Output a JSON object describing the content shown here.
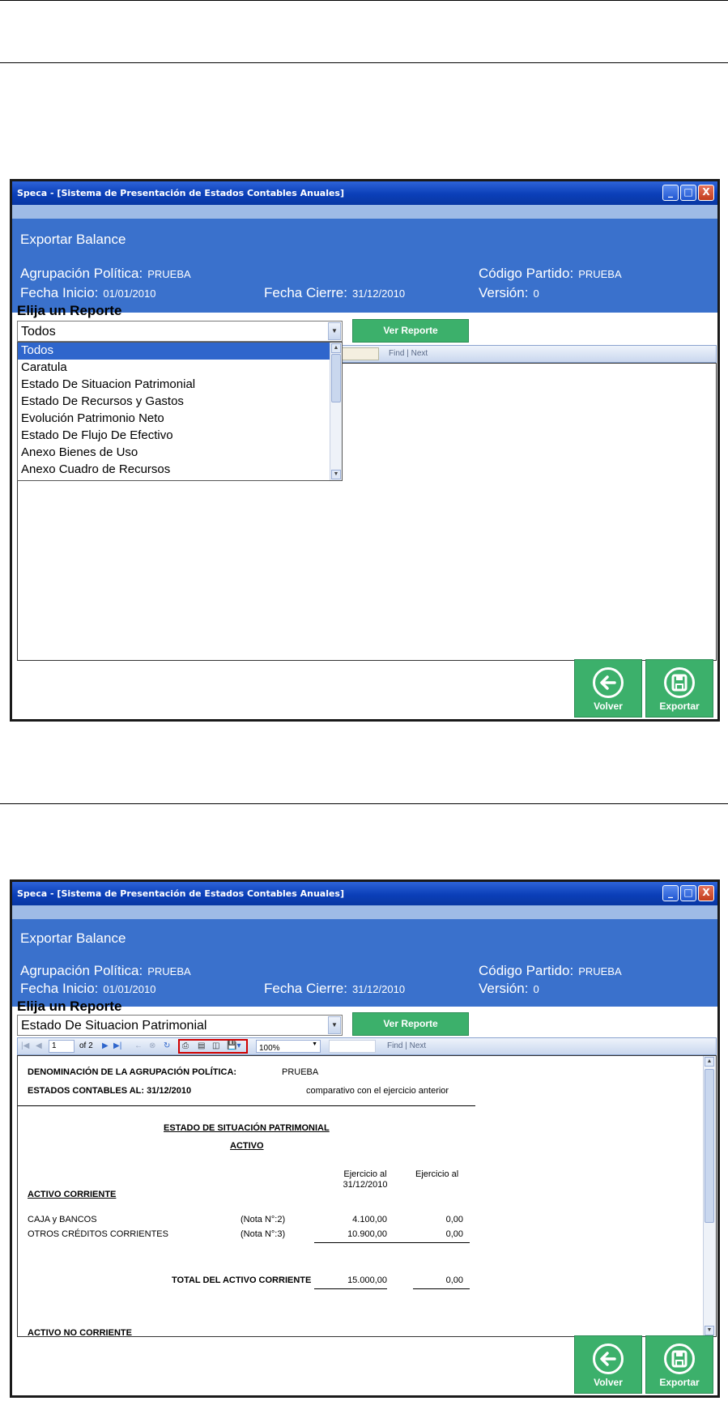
{
  "window": {
    "title": "Speca - [Sistema de Presentación de Estados Contables Anuales]",
    "min_glyph": "_",
    "max_glyph": "□",
    "close_glyph": "X"
  },
  "header": {
    "title": "Exportar Balance",
    "agrupacion_label": "Agrupación Política:",
    "agrupacion_value": "PRUEBA",
    "codigo_label": "Código Partido:",
    "codigo_value": "PRUEBA",
    "fecha_inicio_label": "Fecha Inicio:",
    "fecha_inicio_value": "01/01/2010",
    "fecha_cierre_label": "Fecha Cierre:",
    "fecha_cierre_value": "31/12/2010",
    "version_label": "Versión:",
    "version_value": "0"
  },
  "report_selector": {
    "label": "Elija un Reporte",
    "ver_reporte": "Ver Reporte"
  },
  "screen1": {
    "selected": "Todos",
    "dropdown_items": [
      "Todos",
      "Caratula",
      "Estado De Situacion Patrimonial",
      "Estado De Recursos y Gastos",
      "Evolución Patrimonio Neto",
      "Estado De Flujo De Efectivo",
      "Anexo Bienes de Uso",
      "Anexo Cuadro de Recursos"
    ],
    "toolbar_find": "Find  |  Next"
  },
  "screen2": {
    "selected": "Estado De Situacion Patrimonial",
    "toolbar": {
      "page": "1",
      "of": "of 2",
      "zoom": "100%",
      "find": "Find  |  Next"
    },
    "report": {
      "denominacion_label": "DENOMINACIÓN DE LA AGRUPACIÓN POLÍTICA:",
      "denominacion_value": "PRUEBA",
      "estados_label": "ESTADOS CONTABLES AL: 31/12/2010",
      "comparativo": "comparativo con el ejercicio anterior",
      "title": "ESTADO DE SITUACIÓN PATRIMONIAL",
      "activo": "ACTIVO",
      "col1_line1": "Ejercicio al",
      "col1_line2": "31/12/2010",
      "col2": "Ejercicio al",
      "activo_corriente": "ACTIVO CORRIENTE",
      "rows": [
        {
          "name": "CAJA y BANCOS",
          "nota": "(Nota N°:2)",
          "v1": "4.100,00",
          "v2": "0,00"
        },
        {
          "name": "OTROS CRÉDITOS CORRIENTES",
          "nota": "(Nota N°:3)",
          "v1": "10.900,00",
          "v2": "0,00"
        }
      ],
      "total_label": "TOTAL DEL ACTIVO CORRIENTE",
      "total_v1": "15.000,00",
      "total_v2": "0,00",
      "activo_no_corriente": "ACTIVO NO CORRIENTE"
    }
  },
  "buttons": {
    "volver": "Volver",
    "exportar": "Exportar"
  },
  "colors": {
    "header_blue": "#3a71cc",
    "green": "#3cb06b",
    "selection": "#2f66cc"
  }
}
